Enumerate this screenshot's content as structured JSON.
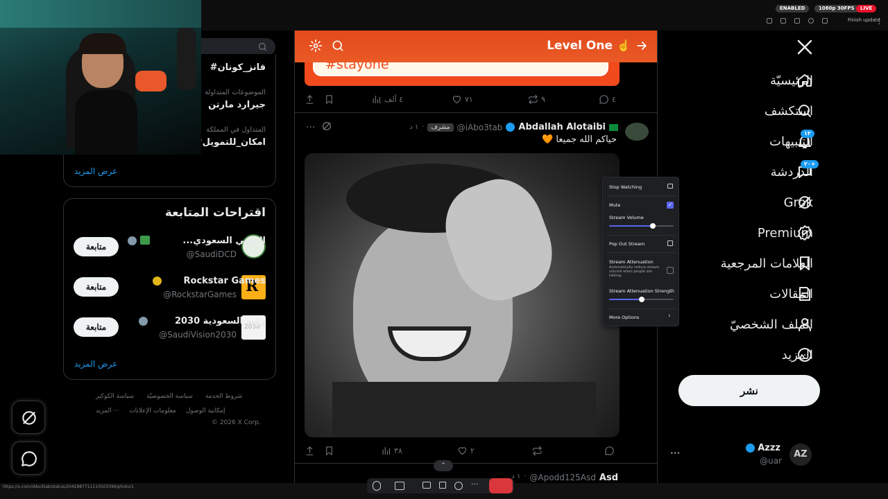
{
  "browser": {
    "enabled_label": "ENABLED",
    "quality_label": "1080p 30FPS",
    "live_label": "LIVE",
    "finish_update": "Finish update"
  },
  "stream_header": {
    "title": "Level One",
    "emoji": "☝️"
  },
  "nav": {
    "items": [
      {
        "label": "الرئيسيّة",
        "icon": "home-icon"
      },
      {
        "label": "استكشف",
        "icon": "search-icon"
      },
      {
        "label": "التنبيهات",
        "icon": "bell-icon",
        "badge": "١٣"
      },
      {
        "label": "الدردشة",
        "icon": "chat-icon",
        "badge": "٢٠+"
      },
      {
        "label": "Grok",
        "icon": "grok-icon"
      },
      {
        "label": "Premium",
        "icon": "verified-icon"
      },
      {
        "label": "العلامات المرجعية",
        "icon": "bookmark-icon"
      },
      {
        "label": "المقالات",
        "icon": "article-icon"
      },
      {
        "label": "الملف الشخصيّ",
        "icon": "profile-icon"
      },
      {
        "label": "المزيد",
        "icon": "more-icon"
      }
    ],
    "post_button": "نشر",
    "account": {
      "name": "Azzz",
      "handle": "@uar",
      "avatar_text": "AZ"
    }
  },
  "trends": {
    "items": [
      {
        "context": "",
        "tag": "#فانز_كونان"
      },
      {
        "context": "الموضوعات المتداولة",
        "tag": "جيرارد مارتن"
      },
      {
        "context": "المتداول في المملكة",
        "tag": "#امكان_للتمويل"
      }
    ],
    "show_more": "عرض المزيد"
  },
  "suggestions": {
    "title": "اقتراحات المتابعة",
    "follow_label": "متابعة",
    "items": [
      {
        "name": "...المدني السعودي",
        "handle": "@SaudiDCD"
      },
      {
        "name": "Rockstar Games",
        "handle": "@RockstarGames"
      },
      {
        "name": "رؤية السعودية 2030",
        "handle": "@SaudiVision2030",
        "avatar_text": "2030"
      }
    ],
    "show_more": "عرض المزيد"
  },
  "footer": {
    "links_row1": [
      "شروط الخدمة",
      "سياسة الخصوصيّة",
      "سياسة الكوكيز"
    ],
    "links_row2": [
      "إمكانية الوصول",
      "معلومات الإعلانات",
      "··· المزيد"
    ],
    "copyright": "© 2026 X Corp."
  },
  "feed": {
    "top_banner_text": "#stayone",
    "post1_stats": {
      "replies": "٤",
      "reposts": "٩",
      "likes": "٧١",
      "views": "٤ ألف"
    },
    "post2": {
      "name": "Abdallah Alotaibi",
      "handle": "@iAbo3tab",
      "role_badge": "مشرف",
      "time": "١ د",
      "text": "حياكم الله جميعا 🧡",
      "stats": {
        "replies": "",
        "reposts": "",
        "likes": "٢",
        "views": "٣٨"
      }
    },
    "post3": {
      "name": "Asd",
      "handle": "@Apodd125Asd",
      "time": "١ د"
    }
  },
  "stream_popup": {
    "stop_watching": "Stop Watching",
    "mute": "Mute",
    "stream_volume": "Stream Volume",
    "volume_level": 0.68,
    "pop_out": "Pop Out Stream",
    "attenuation": "Stream Attenuation",
    "attenuation_desc": "Automatically reduce stream volume when people are talking.",
    "attenuation_strength": "Stream Attenuation Strength",
    "attenuation_level": 0.5,
    "more_options": "More Options"
  },
  "status_url": "https://x.com/iAbo3tab/status/2042987711110503396/photo/1",
  "colors": {
    "accent": "#1d9bf0",
    "discord_blurple": "#5865f2",
    "banner_orange": "#f04a1d",
    "live_red": "#e8132a"
  }
}
